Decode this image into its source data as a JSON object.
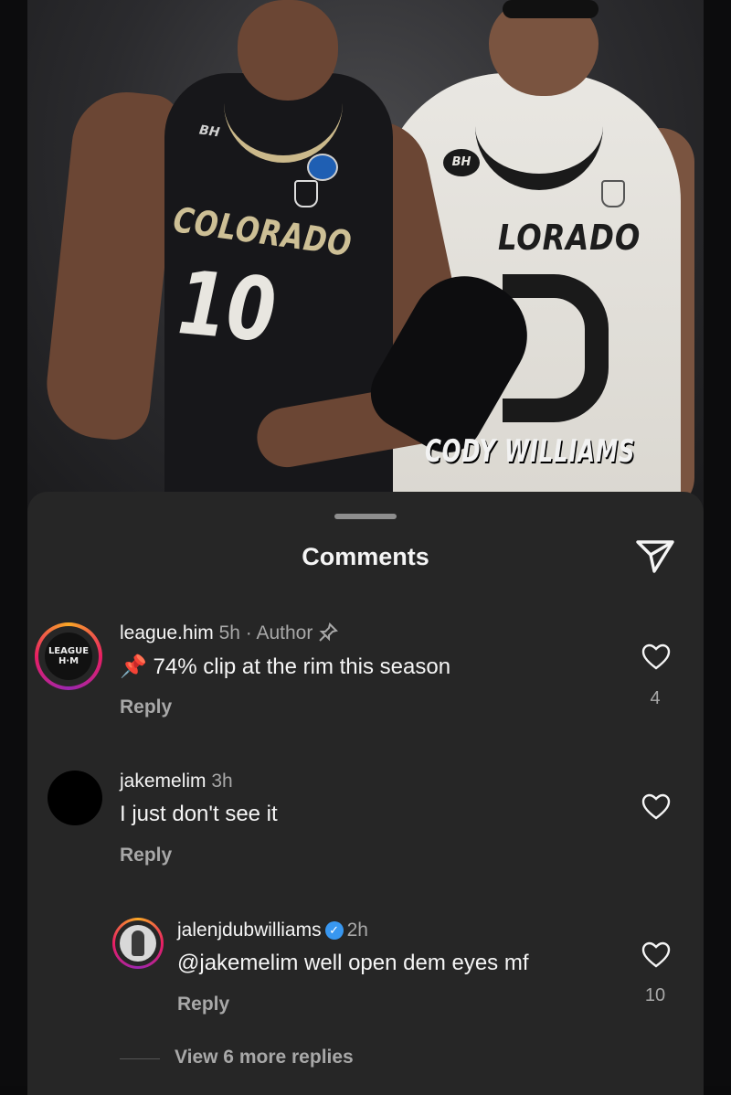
{
  "post_image": {
    "caption": "CODY WILLIAMS",
    "jersey_front_text": "COLORADO",
    "jersey_front_number": "10",
    "jersey_back_text": "LORADO",
    "front_patch": "BH",
    "back_patch": "BH"
  },
  "sheet": {
    "title": "Comments"
  },
  "comments": [
    {
      "username": "league.him",
      "time": "5h",
      "badge": "· Author",
      "pinned": true,
      "text": "📌 74% clip at the rim this season",
      "reply_label": "Reply",
      "likes": "4",
      "avatar_text": "LEAGUE H·M"
    },
    {
      "username": "jakemelim",
      "time": "3h",
      "text": "I just don't see it",
      "reply_label": "Reply",
      "likes": ""
    },
    {
      "username": "jalenjdubwilliams",
      "verified": true,
      "time": "2h",
      "text": "@jakemelim well open dem eyes mf",
      "reply_label": "Reply",
      "likes": "10"
    }
  ],
  "view_more_label": "View 6 more replies",
  "colors": {
    "sheet_bg": "#262626",
    "secondary_text": "#a8a8a8",
    "verified_blue": "#3897f0"
  }
}
